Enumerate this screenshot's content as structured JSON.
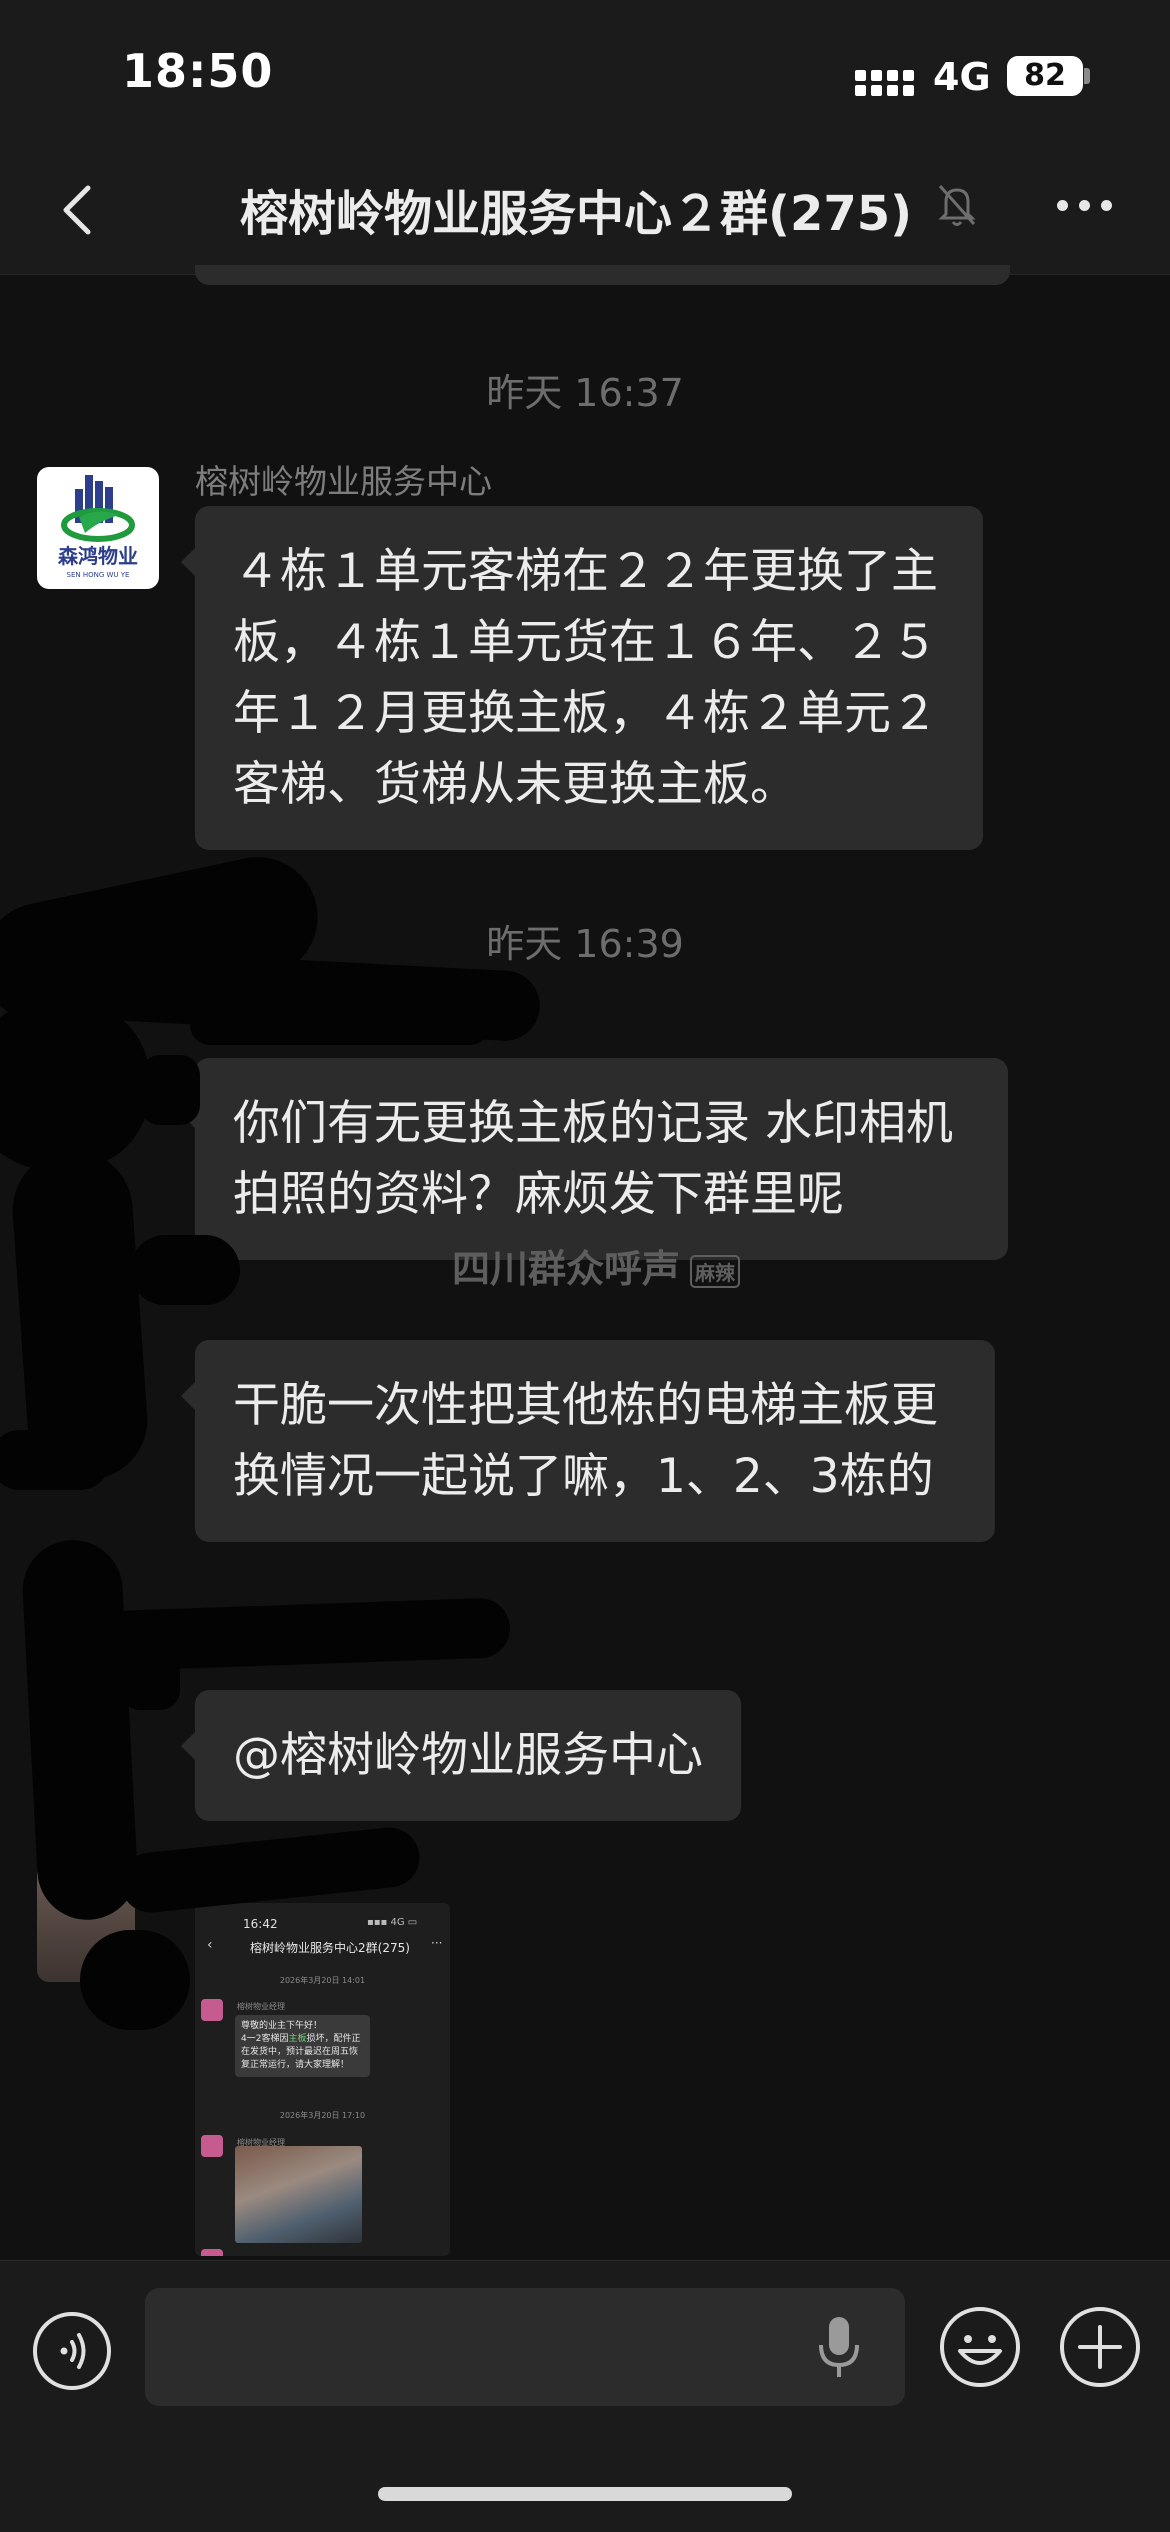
{
  "status_bar": {
    "time": "18:50",
    "network": "4G",
    "battery": "82"
  },
  "header": {
    "title": "榕树岭物业服务中心２群(275)",
    "muted_icon": "bell-slash-icon",
    "more_icon": "more-icon"
  },
  "messages": [
    {
      "timestamp": "昨天 16:37",
      "sender": "榕树岭物业服务中心",
      "text": "４栋１单元客梯在２２年更换了主板，４栋１单元货在１６年、２５年１２月更换主板，４栋２单元２客梯、货梯从未更换主板。"
    },
    {
      "timestamp": "昨天 16:39",
      "text": "你们有无更换主板的记录 水印相机拍照的资料？麻烦发下群里呢"
    },
    {
      "text": "干脆一次性把其他栋的电梯主板更换情况一起说了嘛，1、2、3栋的"
    },
    {
      "text": "@榕树岭物业服务中心"
    }
  ],
  "watermark": {
    "text": "四川群众呼声",
    "badge": "麻辣"
  },
  "embedded_screenshot": {
    "time": "16:42",
    "title": "榕树岭物业服务中心2群(275)",
    "timestamp_1": "2026年3月20日 14:01",
    "sender": "榕树物业经理",
    "message_lines": [
      "尊敬的业主下午好！",
      "4一2客梯因",
      "主板",
      "损坏，配件正在发货中，预计最迟在周五恢复正常运行，请大家理解！"
    ],
    "timestamp_2": "2026年3月20日 17:10"
  },
  "input_bar": {
    "placeholder": "",
    "voice_icon": "voice-icon",
    "mic_icon": "mic-icon",
    "emoji_icon": "emoji-icon",
    "plus_icon": "plus-icon"
  }
}
